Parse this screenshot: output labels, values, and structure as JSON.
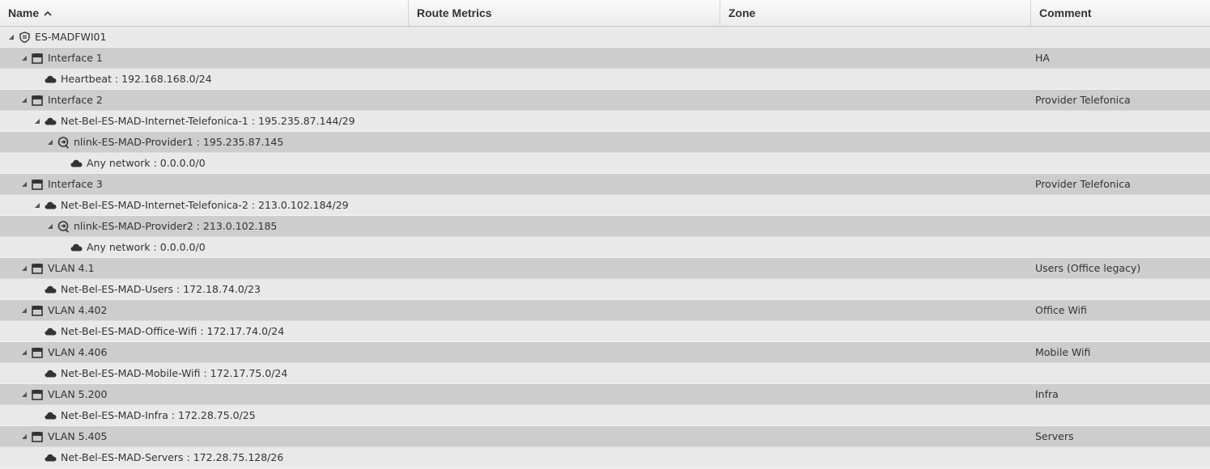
{
  "columns": {
    "name": "Name",
    "route_metrics": "Route Metrics",
    "zone": "Zone",
    "comment": "Comment"
  },
  "rows": [
    {
      "label": "ES-MADFWI01",
      "comment": "",
      "icon": "firewall-icon",
      "expanded": true
    },
    {
      "label": "Interface 1",
      "comment": "HA",
      "icon": "interface-icon",
      "expanded": true
    },
    {
      "label": "Heartbeat : 192.168.168.0/24",
      "comment": "",
      "icon": "cloud-icon",
      "expanded": false
    },
    {
      "label": "Interface 2",
      "comment": "Provider Telefonica",
      "icon": "interface-icon",
      "expanded": true
    },
    {
      "label": "Net-Bel-ES-MAD-Internet-Telefonica-1 : 195.235.87.144/29",
      "comment": "",
      "icon": "cloud-icon",
      "expanded": true
    },
    {
      "label": "nlink-ES-MAD-Provider1 : 195.235.87.145",
      "comment": "",
      "icon": "router-icon",
      "expanded": true
    },
    {
      "label": "Any network : 0.0.0.0/0",
      "comment": "",
      "icon": "cloud-icon",
      "expanded": false
    },
    {
      "label": "Interface 3",
      "comment": "Provider Telefonica",
      "icon": "interface-icon",
      "expanded": true
    },
    {
      "label": "Net-Bel-ES-MAD-Internet-Telefonica-2 : 213.0.102.184/29",
      "comment": "",
      "icon": "cloud-icon",
      "expanded": true
    },
    {
      "label": "nlink-ES-MAD-Provider2 : 213.0.102.185",
      "comment": "",
      "icon": "router-icon",
      "expanded": true
    },
    {
      "label": "Any network : 0.0.0.0/0",
      "comment": "",
      "icon": "cloud-icon",
      "expanded": false
    },
    {
      "label": "VLAN 4.1",
      "comment": "Users (Office legacy)",
      "icon": "interface-icon",
      "expanded": true
    },
    {
      "label": "Net-Bel-ES-MAD-Users : 172.18.74.0/23",
      "comment": "",
      "icon": "cloud-icon",
      "expanded": false
    },
    {
      "label": "VLAN 4.402",
      "comment": "Office Wifi",
      "icon": "interface-icon",
      "expanded": true
    },
    {
      "label": "Net-Bel-ES-MAD-Office-Wifi : 172.17.74.0/24",
      "comment": "",
      "icon": "cloud-icon",
      "expanded": false
    },
    {
      "label": "VLAN 4.406",
      "comment": "Mobile Wifi",
      "icon": "interface-icon",
      "expanded": true
    },
    {
      "label": "Net-Bel-ES-MAD-Mobile-Wifi : 172.17.75.0/24",
      "comment": "",
      "icon": "cloud-icon",
      "expanded": false
    },
    {
      "label": "VLAN 5.200",
      "comment": "Infra",
      "icon": "interface-icon",
      "expanded": true
    },
    {
      "label": "Net-Bel-ES-MAD-Infra : 172.28.75.0/25",
      "comment": "",
      "icon": "cloud-icon",
      "expanded": false
    },
    {
      "label": "VLAN 5.405",
      "comment": "Servers",
      "icon": "interface-icon",
      "expanded": true
    },
    {
      "label": "Net-Bel-ES-MAD-Servers : 172.28.75.128/26",
      "comment": "",
      "icon": "cloud-icon",
      "expanded": false
    }
  ]
}
